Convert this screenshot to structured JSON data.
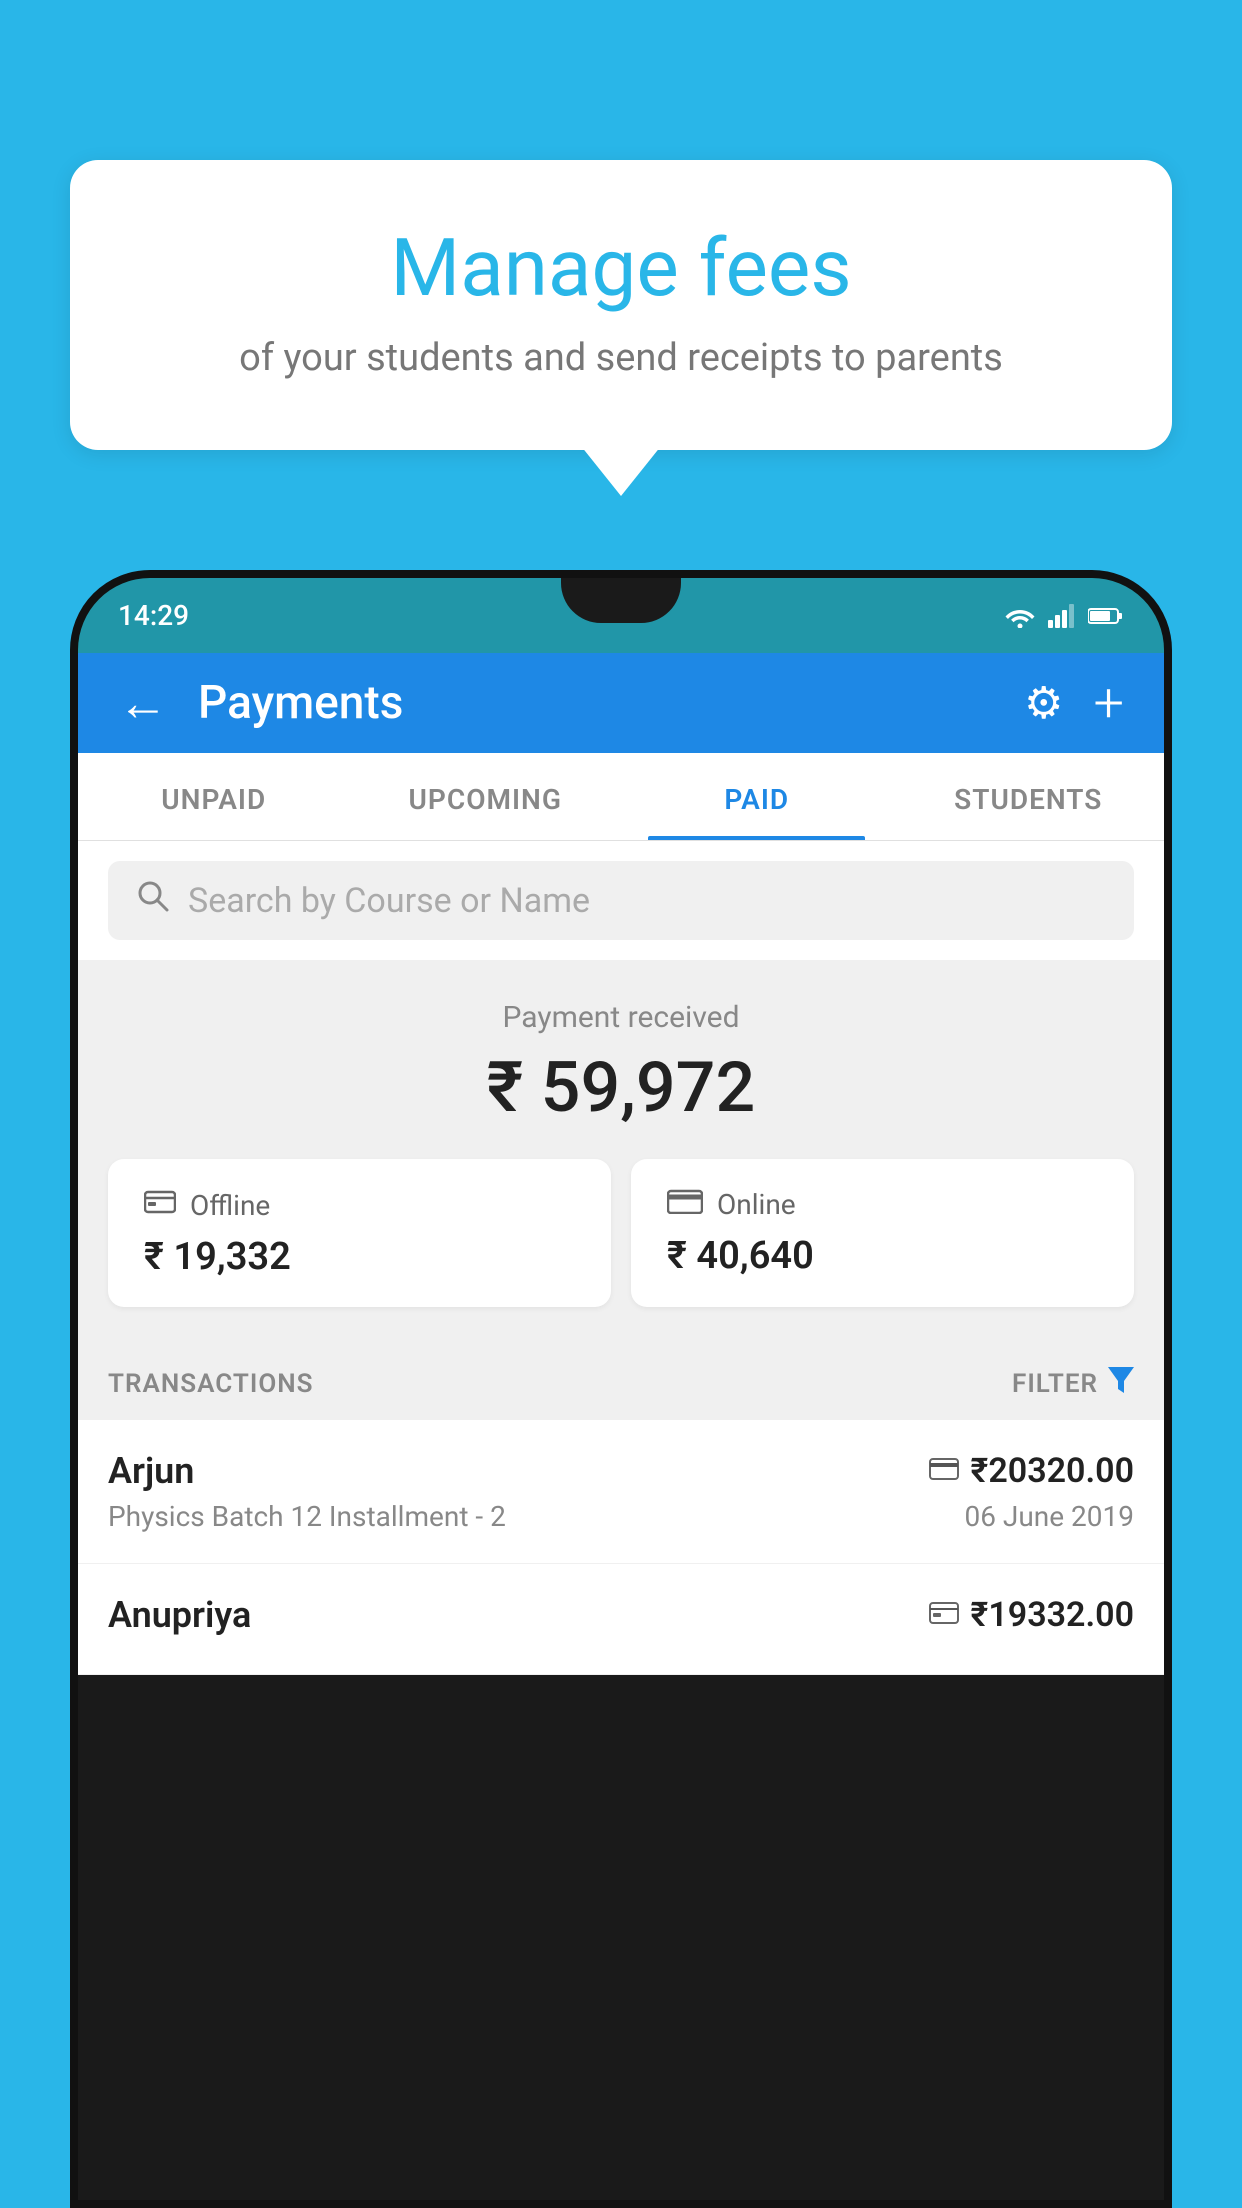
{
  "background_color": "#29B6E8",
  "tooltip": {
    "title": "Manage fees",
    "subtitle": "of your students and send receipts to parents"
  },
  "phone": {
    "status_bar": {
      "time": "14:29",
      "wifi": "wifi",
      "signal": "signal",
      "battery": "battery"
    },
    "header": {
      "back_label": "←",
      "title": "Payments",
      "settings_icon": "⚙",
      "add_icon": "+"
    },
    "tabs": [
      {
        "label": "UNPAID",
        "active": false
      },
      {
        "label": "UPCOMING",
        "active": false
      },
      {
        "label": "PAID",
        "active": true
      },
      {
        "label": "STUDENTS",
        "active": false
      }
    ],
    "search": {
      "placeholder": "Search by Course or Name",
      "search_icon": "🔍"
    },
    "payment_summary": {
      "label": "Payment received",
      "total_amount": "₹ 59,972",
      "offline": {
        "icon": "🧾",
        "label": "Offline",
        "amount": "₹ 19,332"
      },
      "online": {
        "icon": "💳",
        "label": "Online",
        "amount": "₹ 40,640"
      }
    },
    "transactions": {
      "header_label": "TRANSACTIONS",
      "filter_label": "FILTER",
      "items": [
        {
          "name": "Arjun",
          "payment_icon": "💳",
          "amount": "₹20320.00",
          "course": "Physics Batch 12 Installment - 2",
          "date": "06 June 2019"
        },
        {
          "name": "Anupriya",
          "payment_icon": "🧾",
          "amount": "₹19332.00",
          "course": "",
          "date": ""
        }
      ]
    }
  }
}
